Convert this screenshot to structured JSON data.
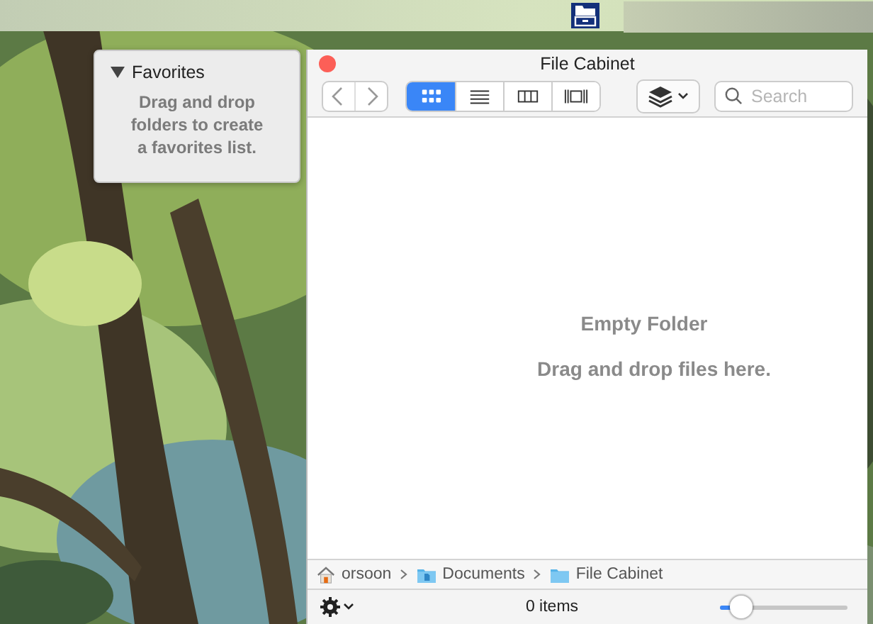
{
  "favorites": {
    "title": "Favorites",
    "expanded": true,
    "hint": "Drag and drop folders to create a favorites list."
  },
  "window": {
    "title": "File Cabinet"
  },
  "view_modes": [
    {
      "kind": "icons",
      "selected": true
    },
    {
      "kind": "list",
      "selected": false
    },
    {
      "kind": "columns",
      "selected": false
    },
    {
      "kind": "gallery",
      "selected": false
    }
  ],
  "search": {
    "placeholder": "Search"
  },
  "content": {
    "title": "Empty Folder",
    "hint": "Drag and drop files here."
  },
  "path": [
    {
      "kind": "home",
      "label": "orsoon"
    },
    {
      "kind": "documents",
      "label": "Documents"
    },
    {
      "kind": "folder",
      "label": "File Cabinet"
    }
  ],
  "status": {
    "count": "0 items",
    "icon_size": {
      "level": 0.17
    }
  }
}
